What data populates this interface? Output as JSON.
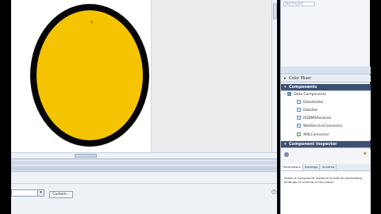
{
  "window": {
    "letterbox_color": "#000000"
  },
  "stage": {
    "shape_fill": "#f4c400",
    "shape_stroke": "#050505"
  },
  "right_panel": {
    "project_field": "Test Project",
    "color_mixer_label": "Color Mixer",
    "components_label": "Components",
    "tree": {
      "group_label": "Data Components",
      "items": [
        "DataHolder",
        "DataSet",
        "RDBMSResolver",
        "WebServiceConnector",
        "XMLConnector"
      ]
    },
    "inspector_label": "Component Inspector",
    "inspector_tabs": [
      "Parameters",
      "Bindings",
      "Schema"
    ],
    "inspector_message": "Select a Component instance to edit its parameters, bindings or schema in this panel."
  },
  "properties": {
    "custom_button": "Custom..."
  },
  "icons": {
    "triangle_right": "▸",
    "triangle_down": "▾",
    "chevron": "▾",
    "help": "?",
    "crosshair": "+"
  }
}
